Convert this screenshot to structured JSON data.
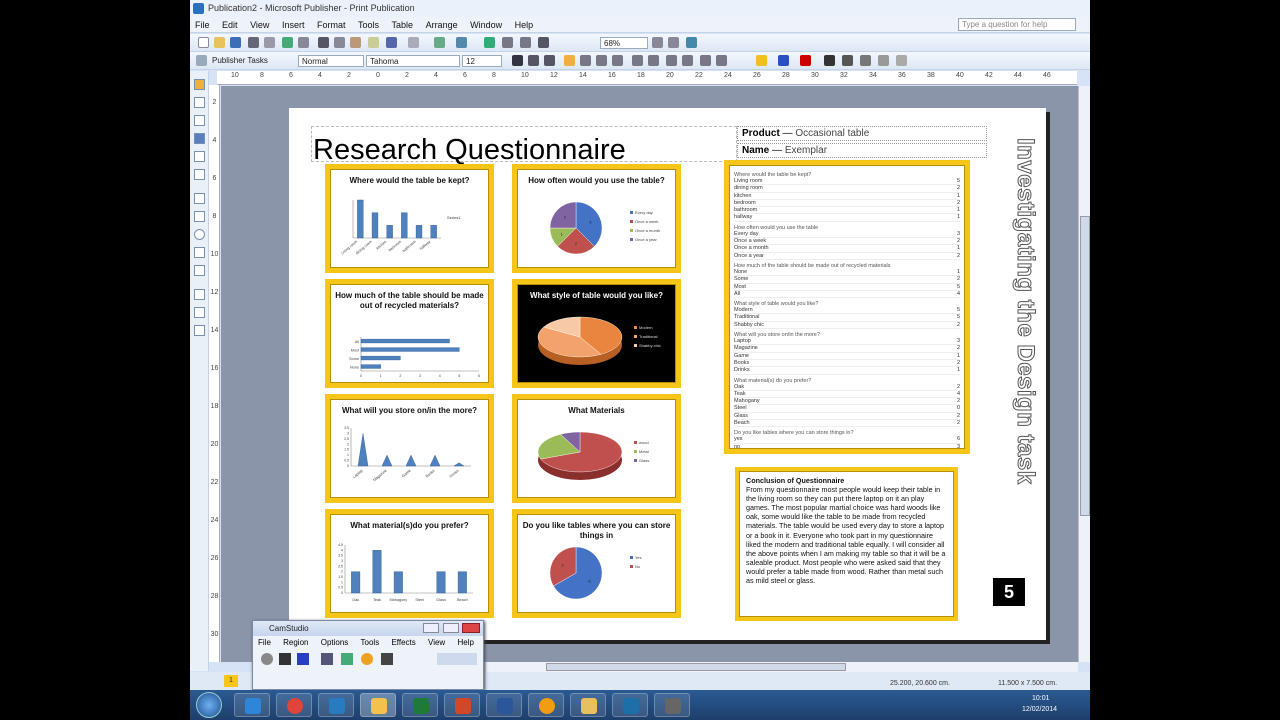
{
  "window": {
    "title": "Publication2 - Microsoft Publisher - Print Publication",
    "ask_placeholder": "Type a question for help"
  },
  "menu": [
    "File",
    "Edit",
    "View",
    "Insert",
    "Format",
    "Tools",
    "Table",
    "Arrange",
    "Window",
    "Help"
  ],
  "toolbar": {
    "zoom": "68%",
    "tasks_label": "Publisher Tasks",
    "style": "Normal",
    "font": "Tahoma",
    "size": "12"
  },
  "ruler": {
    "top": [
      "10",
      "8",
      "6",
      "4",
      "2",
      "0",
      "2",
      "4",
      "6",
      "8",
      "10",
      "12",
      "14",
      "16",
      "18",
      "20",
      "22",
      "24",
      "26",
      "28",
      "30",
      "32",
      "34",
      "36",
      "38",
      "40",
      "42",
      "44",
      "46"
    ],
    "left": [
      "2",
      "4",
      "6",
      "8",
      "10",
      "12",
      "14",
      "16",
      "18",
      "20",
      "22",
      "24",
      "26",
      "28",
      "30"
    ]
  },
  "document": {
    "title": "Research Questionnaire",
    "product_label": "Product",
    "product_value": "Occasional table",
    "name_label": "Name",
    "name_value": "Exemplar",
    "side_title": "Investigating the Design task",
    "page_number": "5"
  },
  "charts": [
    {
      "title": "Where would the table be kept?",
      "type": "bar",
      "categories": [
        "Living room",
        "dining room",
        "kitchen",
        "bedroom",
        "bathroom",
        "hallway"
      ],
      "values": [
        3,
        2,
        1,
        2,
        1,
        1
      ],
      "legend": "Series1"
    },
    {
      "title": "How often would you use the table?",
      "type": "pie",
      "categories": [
        "Every day",
        "Once a week",
        "Once a month",
        "Once a year"
      ],
      "values": [
        3,
        2,
        1,
        2
      ],
      "colors": [
        "#4472c4",
        "#c0504d",
        "#9bbb59",
        "#8064a2"
      ]
    },
    {
      "title": "How much of the table should be made out of recycled materials?",
      "type": "hbar",
      "categories": [
        "All",
        "Most",
        "Some",
        "None"
      ],
      "values": [
        4.5,
        5,
        2,
        1
      ]
    },
    {
      "title": "What style of table would you like?",
      "type": "pie3d",
      "categories": [
        "Modern",
        "Traditional",
        "Shabby chic"
      ],
      "values": [
        5,
        5,
        2
      ],
      "colors": [
        "#e9853e",
        "#f2a26a",
        "#f7c9a6"
      ]
    },
    {
      "title": "What will you store on/in the more?",
      "type": "cone",
      "categories": [
        "Laptop",
        "Magazine",
        "Game",
        "Books",
        "Drinks"
      ],
      "values": [
        3,
        1,
        1,
        1,
        0.3
      ]
    },
    {
      "title": "What Materials",
      "type": "pie3d",
      "categories": [
        "wood",
        "Metal",
        "Glass"
      ],
      "values": [
        9,
        3,
        1
      ],
      "colors": [
        "#c0504d",
        "#9bbb59",
        "#8064a2"
      ]
    },
    {
      "title": "What material(s)do you prefer?",
      "type": "bar",
      "categories": [
        "Oak",
        "Teak",
        "Mahagony",
        "Steel",
        "Glass",
        "Beach"
      ],
      "values": [
        2,
        4,
        2,
        0,
        2,
        2
      ]
    },
    {
      "title": "Do you like tables where you can store things in",
      "type": "pie",
      "categories": [
        "Yes",
        "No"
      ],
      "values": [
        6,
        3
      ],
      "colors": [
        "#4472c4",
        "#c0504d"
      ]
    }
  ],
  "data_sheet": [
    {
      "q": "Where would the table be kept?",
      "rows": [
        [
          "Living room",
          "5"
        ],
        [
          "dining room",
          "2"
        ],
        [
          "kitchen",
          "1"
        ],
        [
          "bedroom",
          "2"
        ],
        [
          "bathroom",
          "1"
        ],
        [
          "hallway",
          "1"
        ]
      ]
    },
    {
      "q": "How often would you use the table",
      "rows": [
        [
          "Every day",
          "3"
        ],
        [
          "Once a week",
          "2"
        ],
        [
          "Once a month",
          "1"
        ],
        [
          "Once a year",
          "2"
        ]
      ]
    },
    {
      "q": "How much of the table should be made out of recycled materials",
      "rows": [
        [
          "None",
          "1"
        ],
        [
          "Some",
          "2"
        ],
        [
          "Most",
          "5"
        ],
        [
          "All",
          "4"
        ]
      ]
    },
    {
      "q": "What style of table would you like?",
      "rows": [
        [
          "Modern",
          "5"
        ],
        [
          "Traditional",
          "5"
        ],
        [
          "Shabby chic",
          "2"
        ]
      ]
    },
    {
      "q": "What will you store on/in the more?",
      "rows": [
        [
          "Laptop",
          "3"
        ],
        [
          "Magazine",
          "2"
        ],
        [
          "Game",
          "1"
        ],
        [
          "Books",
          "2"
        ],
        [
          "Drinks",
          "1"
        ]
      ]
    },
    {
      "q": "What material(s) do you prefer?",
      "rows": [
        [
          "Oak",
          "2"
        ],
        [
          "Teak",
          "4"
        ],
        [
          "Mahogany",
          "2"
        ],
        [
          "Steel",
          "0"
        ],
        [
          "Glass",
          "2"
        ],
        [
          "Beach",
          "2"
        ]
      ]
    },
    {
      "q": "Do you like tables where you can store things in?",
      "rows": [
        [
          "yes",
          "6"
        ],
        [
          "no",
          "3"
        ]
      ]
    }
  ],
  "conclusion": {
    "heading": "Conclusion of Questionnaire",
    "body": "From my questionnaire most people would keep their table in the living room so they can put there laptop on it an play games. The most popular martial choice was hard woods like oak, some would like the table to be made from recycled materials. The table would be used every day to store a laptop or a book in it. Everyone who took part in my questionnaire liked the modern and traditional table equally. I will consider all the above points when I am making my table so that it will be a saleable product. Most people who were asked said that they would prefer a table made from wood. Rather than metal such as mild steel or glass."
  },
  "camstudio": {
    "title": "CamStudio",
    "menu": [
      "File",
      "Region",
      "Options",
      "Tools",
      "Effects",
      "View",
      "Help"
    ]
  },
  "status": {
    "page_badge": "1",
    "position": "25.200, 20.600 cm.",
    "size": "11.500 x 7.500 cm."
  },
  "tray": {
    "time": "10:01",
    "date": "12/02/2014"
  }
}
